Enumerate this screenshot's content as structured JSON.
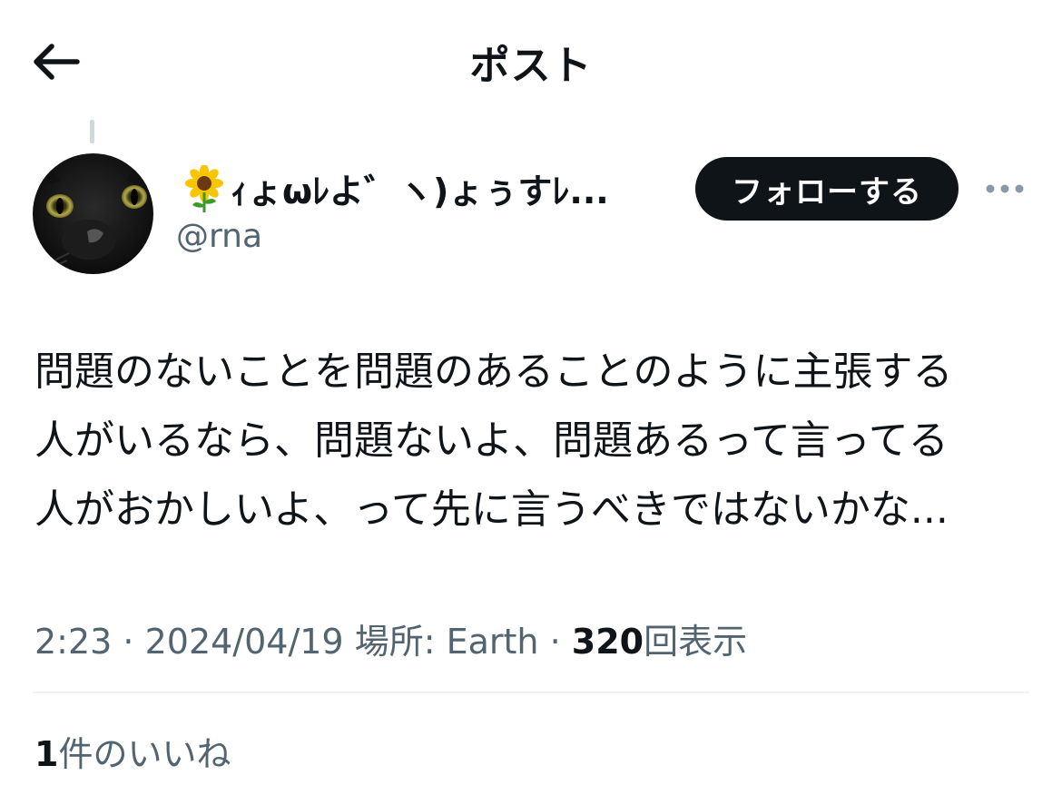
{
  "header": {
    "title": "ポスト",
    "back_icon": "arrow-left-icon"
  },
  "author": {
    "display_name": "ｨょωﾚよ゛ヽ)ょぅすﾚ...",
    "name_icon": "sunflower-icon",
    "handle": "@rna",
    "avatar": "black-cat-avatar"
  },
  "actions": {
    "follow_label": "フォローする",
    "more_icon": "more-horizontal-icon"
  },
  "post": {
    "lines": [
      "問題のないことを問題のあることのように主張する",
      "人がいるなら、問題ないよ、問題あるって言ってる",
      "人がおかしいよ、って先に言うべきではないかな..."
    ]
  },
  "meta": {
    "time": "2:23",
    "sep1": " · ",
    "date": "2024/04/19",
    "location": " 場所: Earth",
    "sep2": " · ",
    "views_count": "320",
    "views_label": "回表示"
  },
  "likes": {
    "count": "1",
    "label": "件のいいね"
  },
  "colors": {
    "text_primary": "#0f1419",
    "text_secondary": "#536471",
    "divider": "#eff3f4",
    "button_bg": "#0f1419"
  }
}
